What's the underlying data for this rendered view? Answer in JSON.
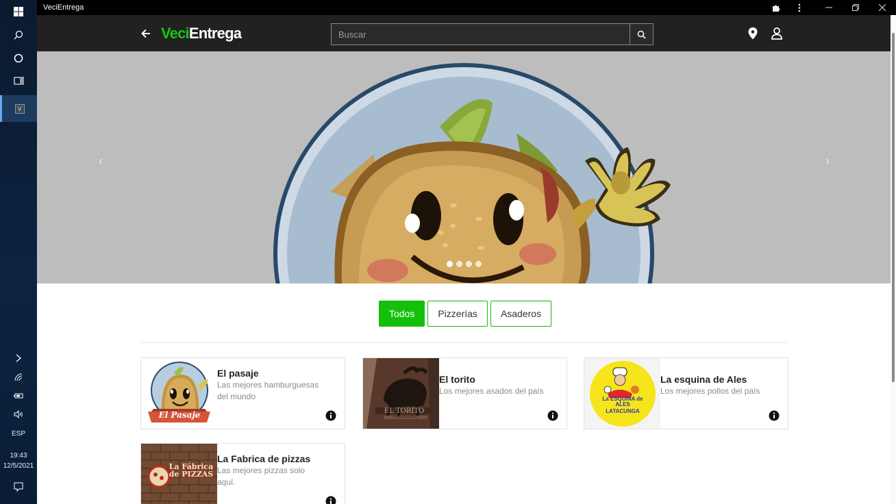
{
  "window": {
    "title": "VeciEntrega"
  },
  "taskbar": {
    "language": "ESP",
    "time": "19:43",
    "date": "12/5/2021",
    "app_letter": "V"
  },
  "header": {
    "logo_part1": "Veci",
    "logo_part2": "Entrega",
    "search_placeholder": "Buscar"
  },
  "carousel": {
    "slide_count": 4,
    "active_slide": 1
  },
  "filters": [
    {
      "label": "Todos",
      "active": true
    },
    {
      "label": "Pizzerías",
      "active": false
    },
    {
      "label": "Asaderos",
      "active": false
    }
  ],
  "restaurants": [
    {
      "name": "El pasaje",
      "description": "Las mejores hamburguesas del mundo",
      "logo_text": "El Pasaje"
    },
    {
      "name": "El torito",
      "description": "Los mejores asados del país",
      "logo_text": "EL TORITO",
      "logo_subtext": "PARRILLERO"
    },
    {
      "name": "La esquina de Ales",
      "description": "Los mejores pollos del país",
      "logo_text": "La ESQUINA de ALES",
      "logo_subtext": "LATACUNGA"
    },
    {
      "name": "La Fabrica de pizzas",
      "description": "Las mejores pizzas solo aquí.",
      "logo_text": "La Fábrica de PIZZAS"
    }
  ],
  "colors": {
    "brand_green": "#13c10b",
    "header_bg": "#212121"
  }
}
